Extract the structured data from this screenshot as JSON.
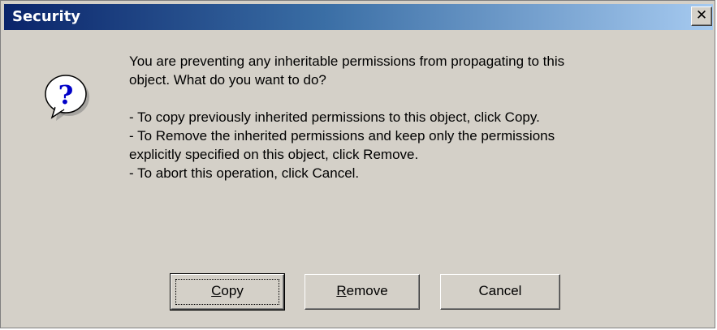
{
  "window": {
    "title": "Security",
    "close_glyph": "✕"
  },
  "icon": {
    "name": "question-icon",
    "glyph": "?"
  },
  "message": {
    "line1": "You are preventing any inheritable permissions from propagating to this",
    "line2": "object.  What do you want to do?",
    "line3": "- To copy previously inherited permissions to this object, click Copy.",
    "line4": "- To Remove the inherited permissions and keep only the permissions",
    "line5": "explicitly specified on this object, click Remove.",
    "line6": "- To abort this operation, click Cancel."
  },
  "buttons": {
    "copy": {
      "accel": "C",
      "rest": "opy"
    },
    "remove": {
      "accel": "R",
      "rest": "emove"
    },
    "cancel": {
      "label": "Cancel"
    }
  }
}
